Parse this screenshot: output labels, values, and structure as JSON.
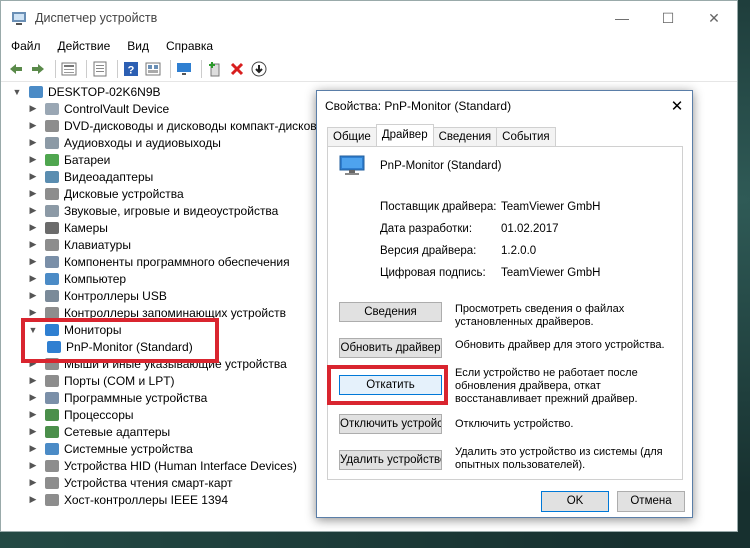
{
  "window": {
    "title": "Диспетчер устройств",
    "controls": {
      "minimize": "—",
      "maximize": "☐",
      "close": "✕"
    }
  },
  "menu": [
    "Файл",
    "Действие",
    "Вид",
    "Справка"
  ],
  "toolbar": [
    "back-icon",
    "forward-icon",
    "properties-icon",
    "list-icon",
    "help-icon",
    "view-icon",
    "monitor-icon",
    "add-driver-icon",
    "remove-icon",
    "download-icon"
  ],
  "tree": {
    "root": "DESKTOP-02K6N9B",
    "items": [
      {
        "label": "ControlVault Device",
        "color": "#9aa7b4"
      },
      {
        "label": "DVD-дисководы и дисководы компакт-дисков",
        "color": "#8d8d8d"
      },
      {
        "label": "Аудиовходы и аудиовыходы",
        "color": "#8c9aa6"
      },
      {
        "label": "Батареи",
        "color": "#4fa64f"
      },
      {
        "label": "Видеоадаптеры",
        "color": "#5a8db0"
      },
      {
        "label": "Дисковые устройства",
        "color": "#8d8d8d"
      },
      {
        "label": "Звуковые, игровые и видеоустройства",
        "color": "#8c9aa6"
      },
      {
        "label": "Камеры",
        "color": "#6b6b6b"
      },
      {
        "label": "Клавиатуры",
        "color": "#8d8d8d"
      },
      {
        "label": "Компоненты программного обеспечения",
        "color": "#7a8fa8"
      },
      {
        "label": "Компьютер",
        "color": "#4b8bc6"
      },
      {
        "label": "Контроллеры USB",
        "color": "#7a8a99"
      },
      {
        "label": "Контроллеры запоминающих устройств",
        "color": "#8d8d8d"
      },
      {
        "label": "Мониторы",
        "color": "#2f7fd1",
        "expanded": true
      },
      {
        "label": "PnP-Monitor (Standard)",
        "color": "#2f7fd1",
        "child": true
      },
      {
        "label": "Мыши и иные указывающие устройства",
        "color": "#8d8d8d"
      },
      {
        "label": "Порты (COM и LPT)",
        "color": "#8d8d8d"
      },
      {
        "label": "Программные устройства",
        "color": "#7a8fa8"
      },
      {
        "label": "Процессоры",
        "color": "#4b8f4b"
      },
      {
        "label": "Сетевые адаптеры",
        "color": "#4b8f4b"
      },
      {
        "label": "Системные устройства",
        "color": "#4b8bc6"
      },
      {
        "label": "Устройства HID (Human Interface Devices)",
        "color": "#8d8d8d"
      },
      {
        "label": "Устройства чтения смарт-карт",
        "color": "#8d8d8d"
      },
      {
        "label": "Хост-контроллеры IEEE 1394",
        "color": "#8d8d8d"
      }
    ]
  },
  "dialog": {
    "title": "Свойства: PnP-Monitor (Standard)",
    "close": "✕",
    "tabs": [
      "Общие",
      "Драйвер",
      "Сведения",
      "События"
    ],
    "device_name": "PnP-Monitor (Standard)",
    "properties": [
      {
        "key": "Поставщик драйвера:",
        "value": "TeamViewer GmbH"
      },
      {
        "key": "Дата разработки:",
        "value": "01.02.2017"
      },
      {
        "key": "Версия драйвера:",
        "value": "1.2.0.0"
      },
      {
        "key": "Цифровая подпись:",
        "value": "TeamViewer GmbH"
      }
    ],
    "actions": [
      {
        "button": "Сведения",
        "desc": "Просмотреть сведения о файлах установленных драйверов."
      },
      {
        "button": "Обновить драйвер",
        "desc": "Обновить драйвер для этого устройства."
      },
      {
        "button": "Откатить",
        "desc": "Если устройство не работает после обновления драйвера, откат восстанавливает прежний драйвер."
      },
      {
        "button": "Отключить устройство",
        "desc": "Отключить устройство."
      },
      {
        "button": "Удалить устройство",
        "desc": "Удалить это устройство из системы (для опытных пользователей)."
      }
    ],
    "ok": "OK",
    "cancel": "Отмена"
  },
  "highlight_color": "#d9252f"
}
